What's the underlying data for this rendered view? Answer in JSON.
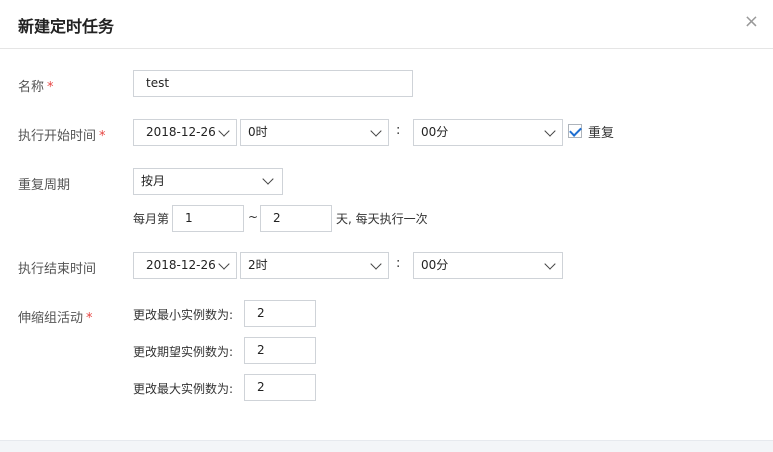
{
  "dialog": {
    "title": "新建定时任务",
    "close_symbol": "×"
  },
  "form": {
    "name": {
      "label": "名称",
      "required_mark": "*",
      "value": "test"
    },
    "start_time": {
      "label": "执行开始时间",
      "required_mark": "*",
      "date": "2018-12-26",
      "hour": "0时",
      "colon": ":",
      "minute": "00分",
      "repeat_label": "重复",
      "repeat_checked": true
    },
    "repeat_cycle": {
      "label": "重复周期",
      "value": "按月",
      "monthly_prefix": "每月第",
      "from_day": "1",
      "range_sep": "~",
      "to_day": "2",
      "suffix": "天, 每天执行一次"
    },
    "end_time": {
      "label": "执行结束时间",
      "date": "2018-12-26",
      "hour": "2时",
      "colon": ":",
      "minute": "00分"
    },
    "scaling": {
      "label": "伸缩组活动",
      "required_mark": "*",
      "min_label": "更改最小实例数为:",
      "min_value": "2",
      "desired_label": "更改期望实例数为:",
      "desired_value": "2",
      "max_label": "更改最大实例数为:",
      "max_value": "2"
    }
  },
  "icons": {
    "close": "close-icon",
    "dropdown": "chevron-down-icon",
    "check": "checkmark-icon"
  },
  "colors": {
    "required": "#e64340",
    "checkbox_tick": "#1f6fd1",
    "input_border": "#cfd3d8"
  }
}
